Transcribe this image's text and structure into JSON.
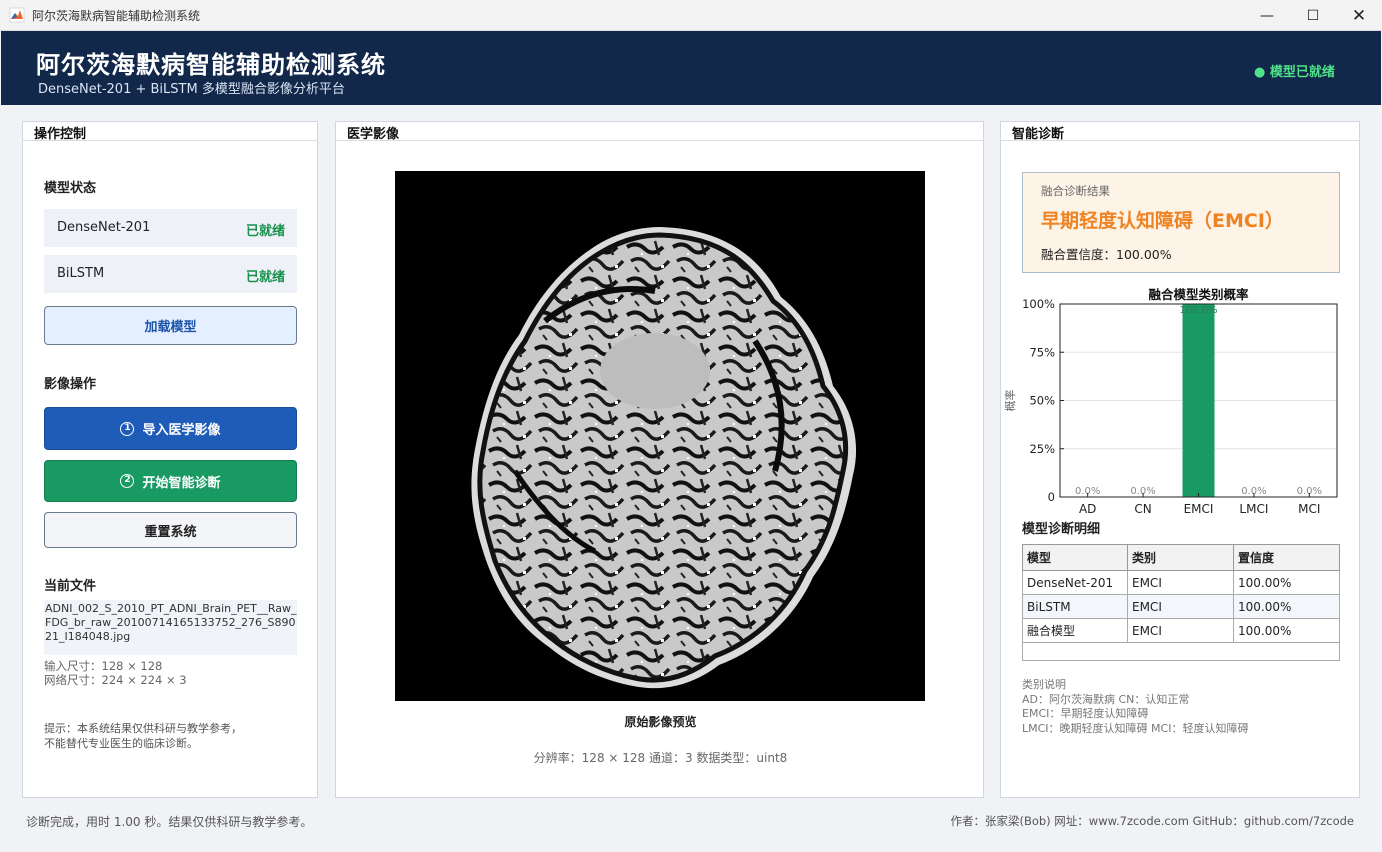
{
  "window": {
    "title": "阿尔茨海默病智能辅助检测系统",
    "min_label": "—",
    "max_label": "☐",
    "close_label": "✕"
  },
  "header": {
    "title": "阿尔茨海默病智能辅助检测系统",
    "subtitle": "DenseNet-201 + BiLSTM 多模型融合影像分析平台",
    "status": "● 模型已就绪",
    "bg_color": "#12284a",
    "status_color": "#4ee38a"
  },
  "left": {
    "title": "操作控制",
    "model_section": "模型状态",
    "models": [
      {
        "name": "DenseNet-201",
        "status": "已就绪"
      },
      {
        "name": "BiLSTM",
        "status": "已就绪"
      }
    ],
    "load_button": "加载模型",
    "image_section": "影像操作",
    "import_num": "1",
    "import_button": "导入医学影像",
    "diagnose_num": "2",
    "diagnose_button": "开始智能诊断",
    "reset_button": "重置系统",
    "file_section": "当前文件",
    "file_name": "ADNI_002_S_2010_PT_ADNI_Brain_PET__Raw_FDG_br_raw_20100714165133752_276_S89021_I184048.jpg",
    "input_size": "输入尺寸：128 × 128",
    "net_size": "网络尺寸：224 × 224 × 3",
    "hint_line1": "提示：本系统结果仅供科研与教学参考，",
    "hint_line2": "不能替代专业医生的临床诊断。"
  },
  "middle": {
    "title": "医学影像",
    "caption": "原始影像预览",
    "meta": "分辨率：128 × 128    通道：3    数据类型：uint8"
  },
  "right": {
    "title": "智能诊断",
    "result_label": "融合诊断结果",
    "result_value": "早期轻度认知障碍（EMCI）",
    "result_conf": "融合置信度：100.00%",
    "detail_title": "模型诊断明细",
    "table_headers": [
      "模型",
      "类别",
      "置信度"
    ],
    "table_rows": [
      [
        "DenseNet-201",
        "EMCI",
        "100.00%"
      ],
      [
        "BiLSTM",
        "EMCI",
        "100.00%"
      ],
      [
        "融合模型",
        "EMCI",
        "100.00%"
      ]
    ],
    "legend_title": "类别说明",
    "legend_line1": "AD：阿尔茨海默病    CN：认知正常",
    "legend_line2": "EMCI：早期轻度认知障碍",
    "legend_line3": "LMCI：晚期轻度认知障碍    MCI：轻度认知障碍"
  },
  "chart_data": {
    "type": "bar",
    "title": "融合模型类别概率",
    "ylabel": "概率",
    "xlabel": "",
    "categories": [
      "AD",
      "CN",
      "EMCI",
      "LMCI",
      "MCI"
    ],
    "values": [
      0.0,
      0.0,
      100.0,
      0.0,
      0.0
    ],
    "value_labels": [
      "0.0%",
      "0.0%",
      "100.0%",
      "0.0%",
      "0.0%"
    ],
    "ylim": [
      0,
      100
    ],
    "yticks": [
      "0",
      "25%",
      "50%",
      "75%",
      "100%"
    ],
    "grid": true,
    "bar_color": "#1a9a63"
  },
  "footer": {
    "left": "诊断完成，用时 1.00 秒。结果仅供科研与教学参考。",
    "right": "作者：张家梁(Bob)  网址：www.7zcode.com  GitHub：github.com/7zcode"
  }
}
